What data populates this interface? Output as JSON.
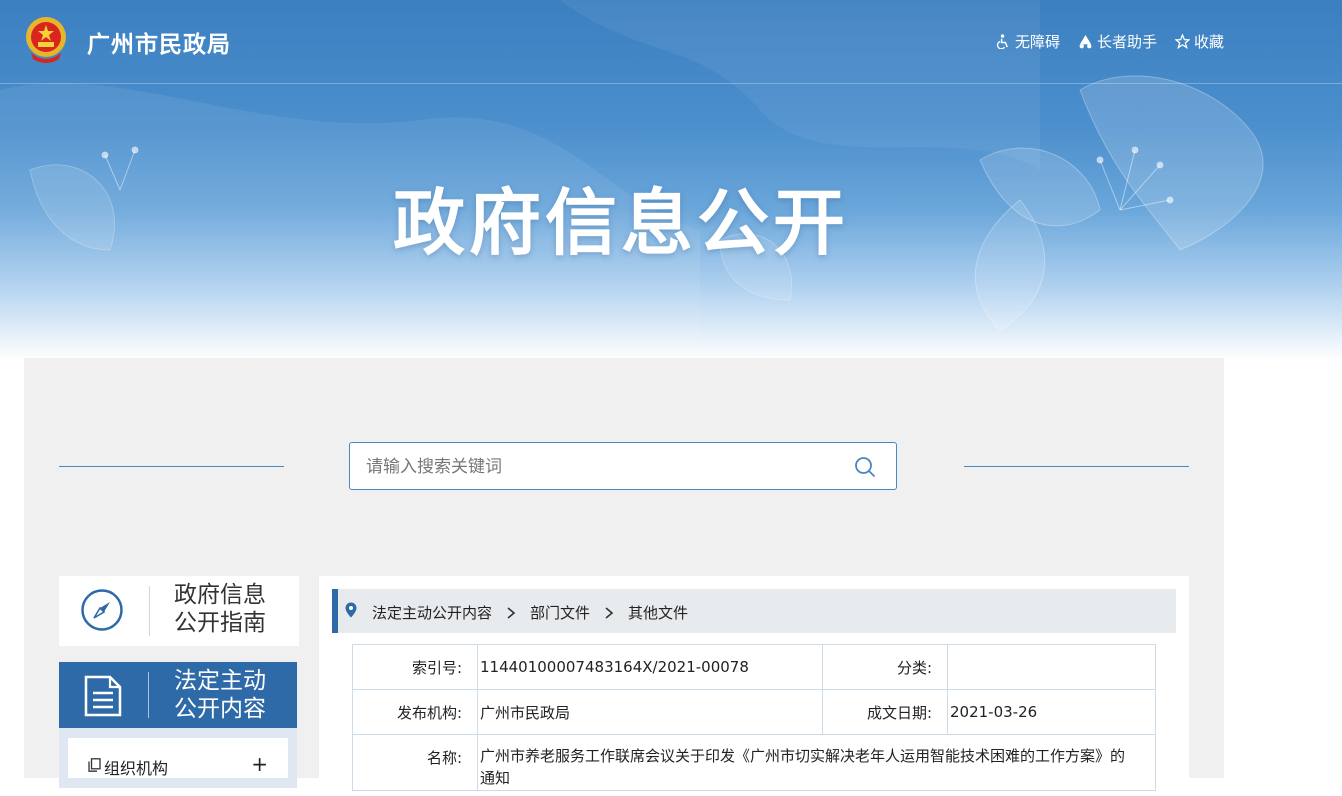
{
  "header": {
    "site_name": "广州市民政局",
    "tools": [
      {
        "label": "无障碍",
        "icon": "accessibility-icon"
      },
      {
        "label": "长者助手",
        "icon": "elder-assist-icon"
      },
      {
        "label": "收藏",
        "icon": "star-icon"
      }
    ]
  },
  "hero": {
    "title": "政府信息公开"
  },
  "search": {
    "placeholder": "请输入搜索关键词"
  },
  "sidebar": {
    "guide": {
      "line1": "政府信息",
      "line2": "公开指南"
    },
    "active": {
      "line1": "法定主动",
      "line2": "公开内容"
    },
    "sub_items": [
      {
        "label": "组织机构",
        "toggle": "+"
      }
    ]
  },
  "breadcrumb": [
    "法定主动公开内容",
    "部门文件",
    "其他文件"
  ],
  "meta": {
    "index_label": "索引号:",
    "index_value": "11440100007483164X/2021-00078",
    "category_label": "分类:",
    "category_value": "",
    "publisher_label": "发布机构:",
    "publisher_value": "广州市民政局",
    "date_label": "成文日期:",
    "date_value": "2021-03-26",
    "name_label": "名称:",
    "name_value": "广州市养老服务工作联席会议关于印发《广州市切实解决老年人运用智能技术困难的工作方案》的通知"
  },
  "colors": {
    "primary": "#2f6aa8",
    "banner_top": "#3b7fc0",
    "main_bg": "#f0f0f0",
    "crumb_bg": "#e7ebee"
  }
}
